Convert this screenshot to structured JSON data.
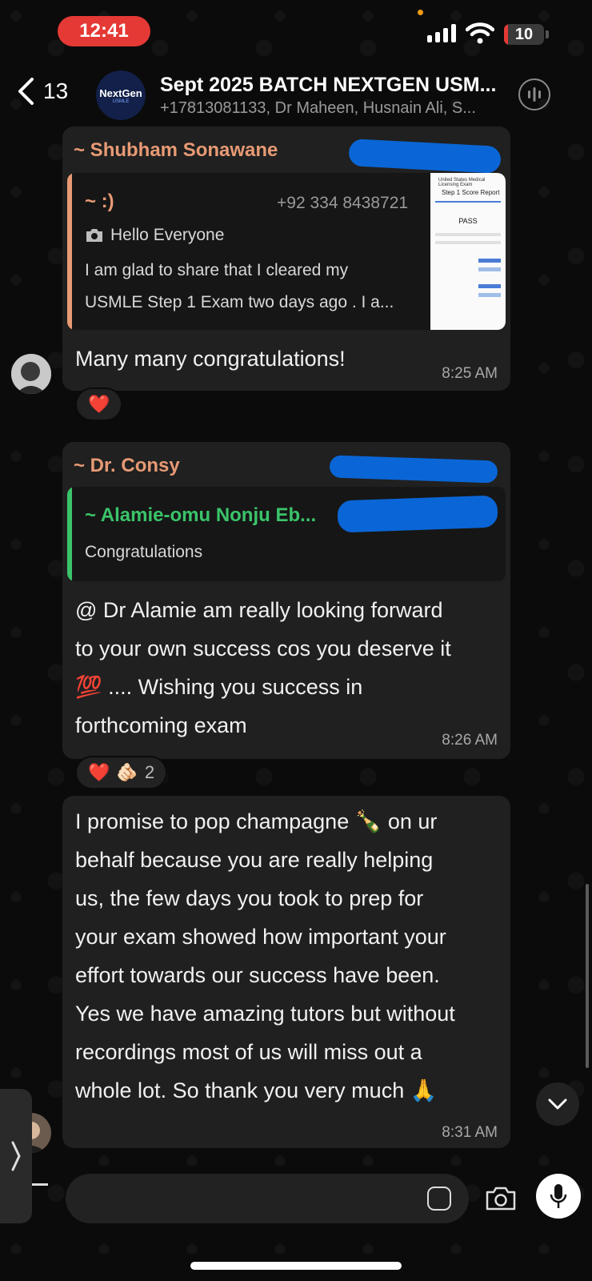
{
  "status_bar": {
    "time": "12:41",
    "battery": "10",
    "battery_fraction": 0.1
  },
  "header": {
    "back_count": "13",
    "avatar_brand": "NextGen",
    "avatar_sub": "USMLE",
    "title": "Sept  2025 BATCH NEXTGEN USM...",
    "members": "+17813081133, Dr Maheen, Husnain Ali, S..."
  },
  "messages": [
    {
      "sender": "~ Shubham Sonawane",
      "quote": {
        "author": "~ :)",
        "phone": "+92 334 8438721",
        "line1": "Hello Everyone",
        "line2": "I am glad to share that I cleared my",
        "line3": "USMLE Step 1 Exam two days ago  . I a...",
        "thumb_title": "United States Medical Licensing Exam",
        "thumb_subtitle": "Step 1 Score Report",
        "thumb_result": "PASS"
      },
      "text": "Many many congratulations!",
      "time": "8:25 AM",
      "reaction": "❤️"
    },
    {
      "sender": "~ Dr. Consy",
      "quote": {
        "author": "~ Alamie-omu Nonju Eb...",
        "text": "Congratulations"
      },
      "text_lines": [
        "@ Dr Alamie am really looking forward",
        "to your own success cos you deserve it",
        "💯 .... Wishing you success in",
        "forthcoming exam"
      ],
      "time": "8:26 AM",
      "reaction_emoji_1": "❤️",
      "reaction_emoji_2": "🫵🏻",
      "reaction_count": "2"
    },
    {
      "text_lines": [
        "I promise to pop champagne 🍾 on ur",
        "behalf because you are really helping",
        "us,  the few days you took to prep for",
        "your exam showed how important your",
        "effort towards our success have been.",
        "Yes we have amazing tutors but without",
        "recordings most of us will miss out a",
        "whole lot. So thank you very much 🙏"
      ],
      "time": "8:31 AM"
    }
  ]
}
